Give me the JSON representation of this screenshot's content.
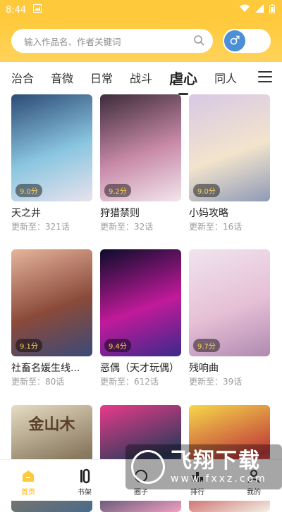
{
  "status_bar": {
    "time": "8:44"
  },
  "search": {
    "placeholder": "输入作品名、作者关键词"
  },
  "gender": {
    "symbol": "♂"
  },
  "tabs": [
    {
      "label": "治合"
    },
    {
      "label": "音微"
    },
    {
      "label": "日常"
    },
    {
      "label": "战斗"
    },
    {
      "label": "虐心",
      "active": true
    },
    {
      "label": "同人"
    }
  ],
  "comics": [
    {
      "title": "天之井",
      "rating": "9.0分",
      "update": "更新至：321话",
      "colors": [
        "#2c4a76",
        "#8ac6e0",
        "#e8e2ec"
      ]
    },
    {
      "title": "狩猎禁则",
      "rating": "9.2分",
      "update": "更新至：32话",
      "colors": [
        "#3d2b3a",
        "#c88aa8",
        "#f2e6ec"
      ]
    },
    {
      "title": "小妈攻略",
      "rating": "9.0分",
      "update": "更新至：16话",
      "colors": [
        "#d8c8e6",
        "#f2e4cc",
        "#8e9ab8"
      ]
    },
    {
      "title": "社畜名媛生线...",
      "rating": "9.1分",
      "update": "更新至：80话",
      "colors": [
        "#e6b49c",
        "#8a4a3a",
        "#3a4a78"
      ]
    },
    {
      "title": "恶偶（天才玩偶）",
      "rating": "9.4分",
      "update": "更新至：612话",
      "colors": [
        "#0c0c2a",
        "#c01a9a",
        "#3a2a8a"
      ]
    },
    {
      "title": "残响曲",
      "rating": "9.7分",
      "update": "更新至：39话",
      "colors": [
        "#f0e4ee",
        "#e6c0d6",
        "#b08ab0"
      ]
    },
    {
      "title": "",
      "rating": "",
      "update": "",
      "colors": [
        "#e6ddc4",
        "#8a7a60",
        "#4a6a8a"
      ],
      "art_text": "金山木"
    },
    {
      "title": "",
      "rating": "",
      "update": "",
      "colors": [
        "#e83a8a",
        "#2a3a5a",
        "#f0a0c0"
      ]
    },
    {
      "title": "",
      "rating": "",
      "update": "",
      "colors": [
        "#f7d84a",
        "#c03a3a",
        "#f2f0e6"
      ]
    }
  ],
  "bottom_nav": [
    {
      "label": "首页",
      "active": true
    },
    {
      "label": "书架"
    },
    {
      "label": "圈子"
    },
    {
      "label": "排行"
    },
    {
      "label": "我的"
    }
  ],
  "watermark": {
    "text": "飞翔下载",
    "url": "www.fxxz.com"
  },
  "colors": {
    "accent": "#ffc93c",
    "active_nav": "#ffb400"
  }
}
